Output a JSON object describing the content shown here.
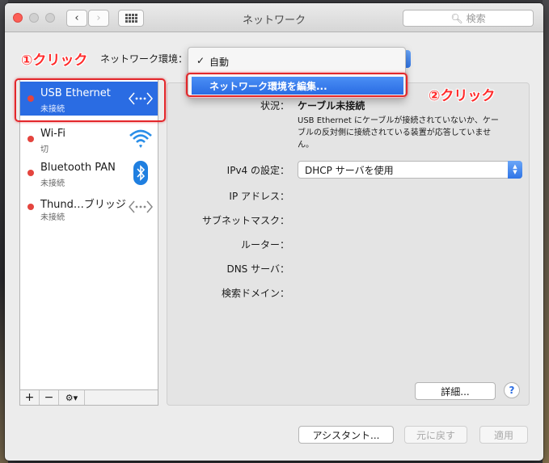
{
  "window": {
    "title": "ネットワーク",
    "search_placeholder": "検索"
  },
  "location": {
    "label": "ネットワーク環境：",
    "menu": {
      "items": [
        "自動",
        "ネットワーク環境を編集..."
      ],
      "checked": "自動"
    }
  },
  "services": [
    {
      "name": "USB Ethernet",
      "status": "未接続",
      "icon": "ethernet-arrows-icon",
      "selected": true
    },
    {
      "name": "Wi-Fi",
      "status": "切",
      "icon": "wifi-icon",
      "selected": false
    },
    {
      "name": "Bluetooth PAN",
      "status": "未接続",
      "icon": "bluetooth-icon",
      "selected": false
    },
    {
      "name": "Thund…ブリッジ",
      "status": "未接続",
      "icon": "ethernet-arrows-icon",
      "selected": false
    }
  ],
  "sidebar_buttons": {
    "add": "+",
    "remove": "−",
    "gear": "⚙▾"
  },
  "detail": {
    "status_label": "状況：",
    "status_value": "ケーブル未接続",
    "status_desc": "USB Ethernet にケーブルが接続されていないか、ケーブルの反対側に接続されている装置が応答していません。",
    "ipv4_label": "IPv4 の設定：",
    "ipv4_value": "DHCP サーバを使用",
    "ip_label": "IP アドレス：",
    "subnet_label": "サブネットマスク：",
    "router_label": "ルーター：",
    "dns_label": "DNS サーバ：",
    "search_domain_label": "検索ドメイン："
  },
  "buttons": {
    "advanced": "詳細...",
    "help": "?",
    "assistant": "アシスタント...",
    "revert": "元に戻す",
    "apply": "適用"
  },
  "annotations": {
    "step1": "①クリック",
    "step2": "②クリック"
  },
  "colors": {
    "accent": "#2a6ce3",
    "status_red": "#e4443e",
    "annotation_red": "#ff2a2a"
  }
}
